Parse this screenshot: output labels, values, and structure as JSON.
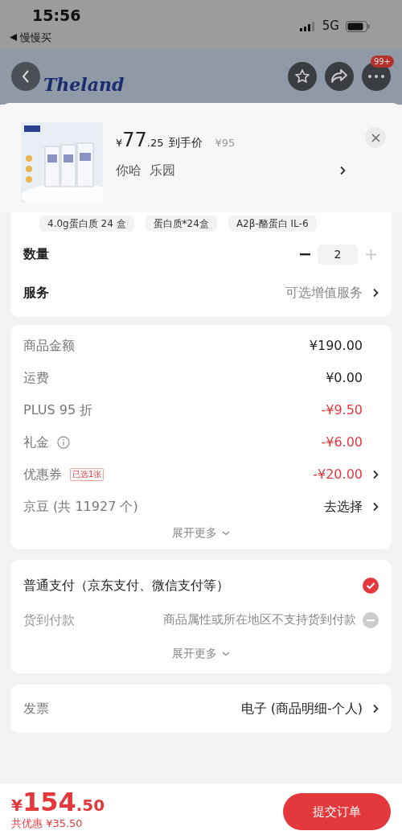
{
  "status_bar": {
    "time": "15:56",
    "back_app": "慢慢买",
    "network": "5G"
  },
  "header": {
    "logo": "Theland",
    "badge": "99+"
  },
  "product": {
    "currency": "¥",
    "price_int": "77",
    "price_dec": ".25",
    "price_label": "到手价",
    "original_price": "¥95",
    "variant": "你哈  乐园"
  },
  "spec_chips": [
    {
      "label": "4.0g蛋白质 24 盒"
    },
    {
      "label": "蛋白质*24盒"
    },
    {
      "label": "A2β-酪蛋白 IL-6"
    }
  ],
  "quantity": {
    "label": "数量",
    "value": "2",
    "increment_disabled": true
  },
  "service": {
    "label": "服务",
    "value": "可选增值服务"
  },
  "price_rows": [
    {
      "label": "商品金额",
      "value": "¥190.00",
      "kind": "plain",
      "info": false,
      "chevron": false
    },
    {
      "label": "运费",
      "value": "¥0.00",
      "kind": "plain",
      "info": false,
      "chevron": false
    },
    {
      "label": "PLUS 95 折",
      "value": "-¥9.50",
      "kind": "discount",
      "info": false,
      "chevron": false
    },
    {
      "label": "礼金",
      "value": "-¥6.00",
      "kind": "discount",
      "info": true,
      "chevron": false
    },
    {
      "label": "优惠券",
      "badge": "已选1张",
      "value": "-¥20.00",
      "kind": "discount",
      "info": false,
      "chevron": true
    },
    {
      "label": "京豆 (共 11927 个)",
      "value": "去选择",
      "kind": "plain",
      "info": false,
      "chevron": true
    }
  ],
  "price_expand": "展开更多",
  "payment": {
    "options": [
      {
        "label": "普通支付（京东支付、微信支付等）",
        "selected": true,
        "disabled": false
      },
      {
        "label": "货到付款",
        "note": "商品属性或所在地区不支持货到付款",
        "selected": false,
        "disabled": true
      }
    ],
    "expand": "展开更多"
  },
  "invoice": {
    "label": "发票",
    "value": "电子 (商品明细-个人)"
  },
  "footer": {
    "currency": "¥",
    "total_int": "154",
    "total_dec": ".50",
    "savings": "共优惠 ¥35.50",
    "submit": "提交订单"
  }
}
